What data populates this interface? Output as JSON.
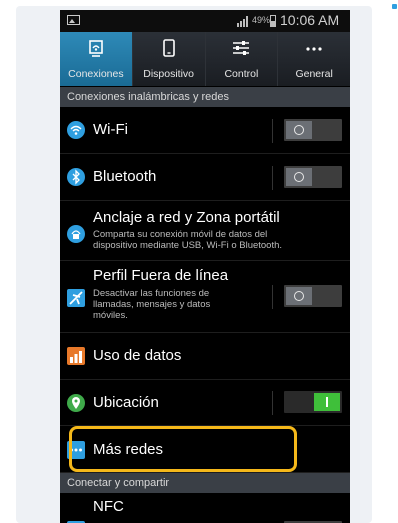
{
  "statusbar": {
    "battery_pct": "49%",
    "time": "10:06 AM"
  },
  "tabs": [
    {
      "label": "Conexiones",
      "icon": "connections-icon",
      "active": true
    },
    {
      "label": "Dispositivo",
      "icon": "device-icon",
      "active": false
    },
    {
      "label": "Control",
      "icon": "sliders-icon",
      "active": false
    },
    {
      "label": "General",
      "icon": "more-icon",
      "active": false
    }
  ],
  "sections": {
    "wireless": "Conexiones inalámbricas y redes",
    "connect_share": "Conectar y compartir"
  },
  "items": {
    "wifi": {
      "title": "Wi-Fi",
      "toggle": "off"
    },
    "bluetooth": {
      "title": "Bluetooth",
      "toggle": "off"
    },
    "tethering": {
      "title": "Anclaje a red y Zona portátil",
      "desc_line1": "Comparta su conexión móvil de datos del",
      "desc_line2": "dispositivo mediante USB, Wi-Fi o Bluetooth."
    },
    "airplane": {
      "title": "Perfil Fuera de línea",
      "desc_line1": "Desactivar las funciones de",
      "desc_line2": "llamadas, mensajes y datos",
      "desc_line3": "móviles.",
      "toggle": "off"
    },
    "data_usage": {
      "title": "Uso de datos"
    },
    "location": {
      "title": "Ubicación",
      "toggle": "on"
    },
    "more_networks": {
      "title": "Más redes"
    },
    "nfc": {
      "title": "NFC"
    }
  },
  "colors": {
    "accent_tab": "#2e8ab8",
    "highlight": "#f5b81a",
    "toggle_on": "#3fbf3a"
  }
}
